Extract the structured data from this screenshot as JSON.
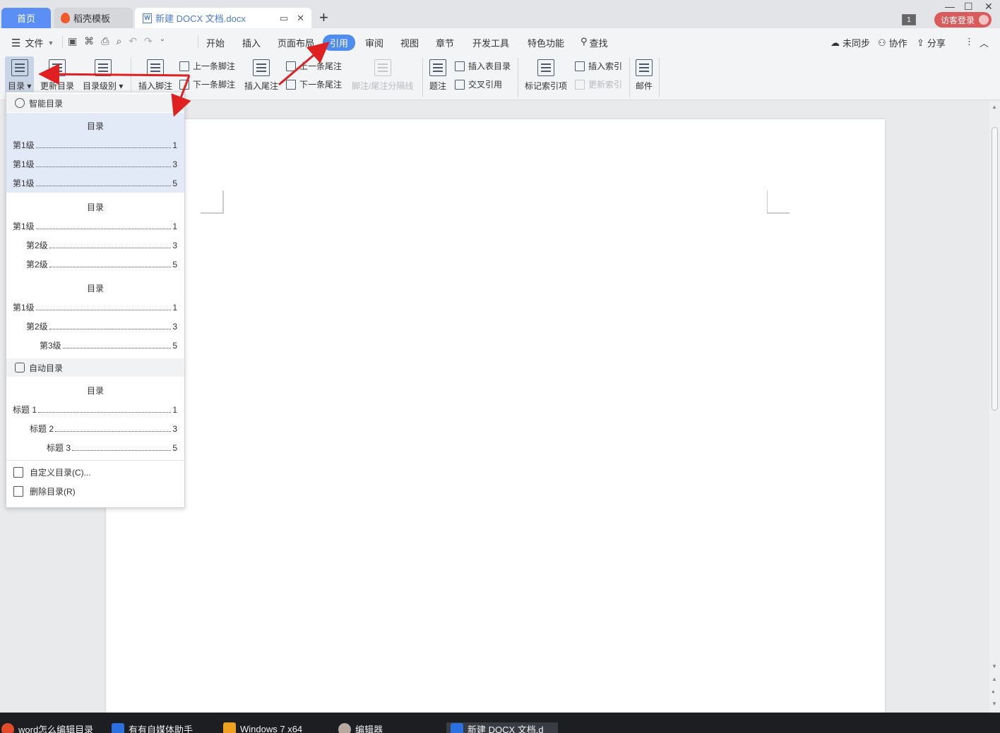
{
  "tabs": {
    "home": "首页",
    "template": "稻壳模板",
    "doc": "新建 DOCX 文档.docx",
    "doc_icon": "W",
    "add": "+"
  },
  "window": {
    "badge": "1",
    "login": "访客登录"
  },
  "menubar": {
    "file": "文件",
    "items": [
      "开始",
      "插入",
      "页面布局",
      "引用",
      "审阅",
      "视图",
      "章节",
      "开发工具",
      "特色功能",
      "查找"
    ],
    "right": [
      "未同步",
      "协作",
      "分享"
    ]
  },
  "ribbon": {
    "toc": "目录",
    "update_toc": "更新目录",
    "toc_level": "目录级别",
    "insert_footnote": "插入脚注",
    "prev_footnote": "上一条脚注",
    "next_footnote": "下一条脚注",
    "insert_endnote": "插入尾注",
    "prev_endnote": "上一条尾注",
    "next_endnote": "下一条尾注",
    "separator": "脚注/尾注分隔线",
    "caption": "题注",
    "insert_table_toc": "插入表目录",
    "cross_ref": "交叉引用",
    "mark_index": "标记索引项",
    "insert_index": "插入索引",
    "update_index": "更新索引",
    "mail": "邮件"
  },
  "dropdown": {
    "smart_header": "智能目录",
    "auto_header": "自动目录",
    "blocks": [
      {
        "title": "目录",
        "lines": [
          {
            "text": "第1级",
            "page": "1"
          },
          {
            "text": "第1级",
            "page": "3"
          },
          {
            "text": "第1级",
            "page": "5"
          }
        ]
      },
      {
        "title": "目录",
        "lines": [
          {
            "text": "第1级",
            "page": "1"
          },
          {
            "text": "第2级",
            "page": "3"
          },
          {
            "text": "第2级",
            "page": "5"
          }
        ]
      },
      {
        "title": "目录",
        "lines": [
          {
            "text": "第1级",
            "page": "1"
          },
          {
            "text": "第2级",
            "page": "3"
          },
          {
            "text": "第3级",
            "page": "5"
          }
        ]
      },
      {
        "title": "目录",
        "lines": [
          {
            "text": "标题 1",
            "page": "1"
          },
          {
            "text": "标题 2",
            "page": "3"
          },
          {
            "text": "标题 3",
            "page": "5"
          }
        ]
      }
    ],
    "custom": "自定义目录(C)...",
    "delete": "删除目录(R)"
  },
  "taskbar": {
    "items": [
      "word怎么编辑目录",
      "有有自媒体助手",
      "Windows 7 x64",
      "编辑器",
      "新建 DOCX 文档.d"
    ]
  },
  "colors": {
    "accent": "#4f8cf0",
    "login": "#d95c5c",
    "highlight": "#e2eaf7",
    "arrow": "#e02020"
  }
}
